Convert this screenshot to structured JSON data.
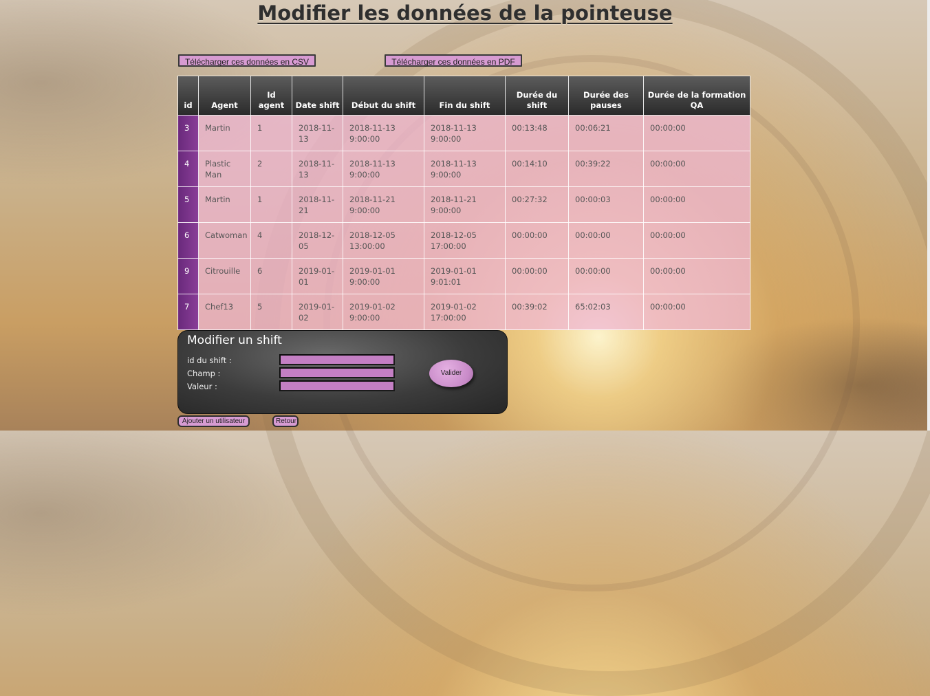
{
  "page": {
    "title": "Modifier les données de la pointeuse"
  },
  "toolbar": {
    "csv_label": "Télécharger ces données en CSV",
    "pdf_label": "Télécharger ces données en PDF"
  },
  "table": {
    "headers": [
      "id",
      "Agent",
      "Id agent",
      "Date shift",
      "Début du shift",
      "Fin du shift",
      "Durée du shift",
      "Durée des pauses",
      "Durée de la formation QA"
    ],
    "rows": [
      [
        "3",
        "Martin",
        "1",
        "2018-11-13",
        "2018-11-13 9:00:00",
        "2018-11-13 9:00:00",
        "00:13:48",
        "00:06:21",
        "00:00:00"
      ],
      [
        "4",
        "Plastic Man",
        "2",
        "2018-11-13",
        "2018-11-13 9:00:00",
        "2018-11-13 9:00:00",
        "00:14:10",
        "00:39:22",
        "00:00:00"
      ],
      [
        "5",
        "Martin",
        "1",
        "2018-11-21",
        "2018-11-21 9:00:00",
        "2018-11-21 9:00:00",
        "00:27:32",
        "00:00:03",
        "00:00:00"
      ],
      [
        "6",
        "Catwoman",
        "4",
        "2018-12-05",
        "2018-12-05 13:00:00",
        "2018-12-05 17:00:00",
        "00:00:00",
        "00:00:00",
        "00:00:00"
      ],
      [
        "9",
        "Citrouille",
        "6",
        "2019-01-01",
        "2019-01-01 9:00:00",
        "2019-01-01 9:01:01",
        "00:00:00",
        "00:00:00",
        "00:00:00"
      ],
      [
        "7",
        "Chef13",
        "5",
        "2019-01-02",
        "2019-01-02 9:00:00",
        "2019-01-02 17:00:00",
        "00:39:02",
        "65:02:03",
        "00:00:00"
      ]
    ]
  },
  "form": {
    "title": "Modifier un shift",
    "id_label": "id du shift :",
    "field_label": "Champ :",
    "value_label": "Valeur :",
    "id_value": "",
    "field_value": "",
    "value_value": "",
    "submit_label": "Valider"
  },
  "footer": {
    "add_user_label": "Ajouter un utilisateur",
    "back_label": "Retour"
  },
  "colors": {
    "accent_pink": "#d79bd2",
    "id_column": "#7a3590",
    "header_dark": "#2a2a2a"
  }
}
